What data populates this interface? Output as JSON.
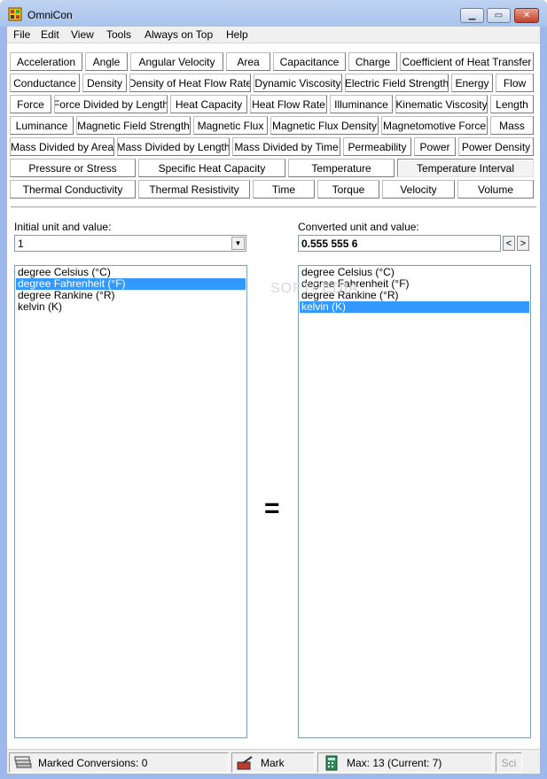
{
  "window": {
    "title": "OmniCon"
  },
  "menu": [
    "File",
    "Edit",
    "View",
    "Tools",
    "Always on Top",
    "Help"
  ],
  "categories": [
    [
      "Acceleration",
      "Angle",
      "Angular Velocity",
      "Area",
      "Capacitance",
      "Charge",
      "Coefficient of Heat Transfer"
    ],
    [
      "Conductance",
      "Density",
      "Density of Heat Flow Rate",
      "Dynamic Viscosity",
      "Electric Field Strength",
      "Energy",
      "Flow"
    ],
    [
      "Force",
      "Force Divided by Length",
      "Heat Capacity",
      "Heat Flow Rate",
      "Illuminance",
      "Kinematic Viscosity",
      "Length"
    ],
    [
      "Luminance",
      "Magnetic Field Strength",
      "Magnetic Flux",
      "Magnetic Flux Density",
      "Magnetomotive Force",
      "Mass"
    ],
    [
      "Mass Divided by Area",
      "Mass Divided by Length",
      "Mass Divided by Time",
      "Permeability",
      "Power",
      "Power Density"
    ],
    [
      "Pressure or Stress",
      "Specific Heat Capacity",
      "Temperature",
      "Temperature Interval"
    ],
    [
      "Thermal Conductivity",
      "Thermal Resistivity",
      "Time",
      "Torque",
      "Velocity",
      "Volume"
    ]
  ],
  "selected_category": "Temperature Interval",
  "initial": {
    "label": "Initial unit and value:",
    "value": "1",
    "units": [
      "degree Celsius (°C)",
      "degree Fahrenheit (°F)",
      "degree Rankine (°R)",
      "kelvin (K)"
    ],
    "selected_index": 1
  },
  "converted": {
    "label": "Converted unit and value:",
    "value": "0.555 555 6",
    "units": [
      "degree Celsius (°C)",
      "degree Fahrenheit (°F)",
      "degree Rankine (°R)",
      "kelvin (K)"
    ],
    "selected_index": 3,
    "prev": "<",
    "next": ">"
  },
  "equals_sign": "=",
  "watermark": "SOFTPEDIA",
  "status": {
    "marked": "Marked Conversions: 0",
    "mark": "Mark",
    "max": "Max: 13 (Current: 7)",
    "sci": "Sci"
  },
  "colors": {
    "selection": "#3399ff",
    "titlebar": "#bfd3f2"
  }
}
